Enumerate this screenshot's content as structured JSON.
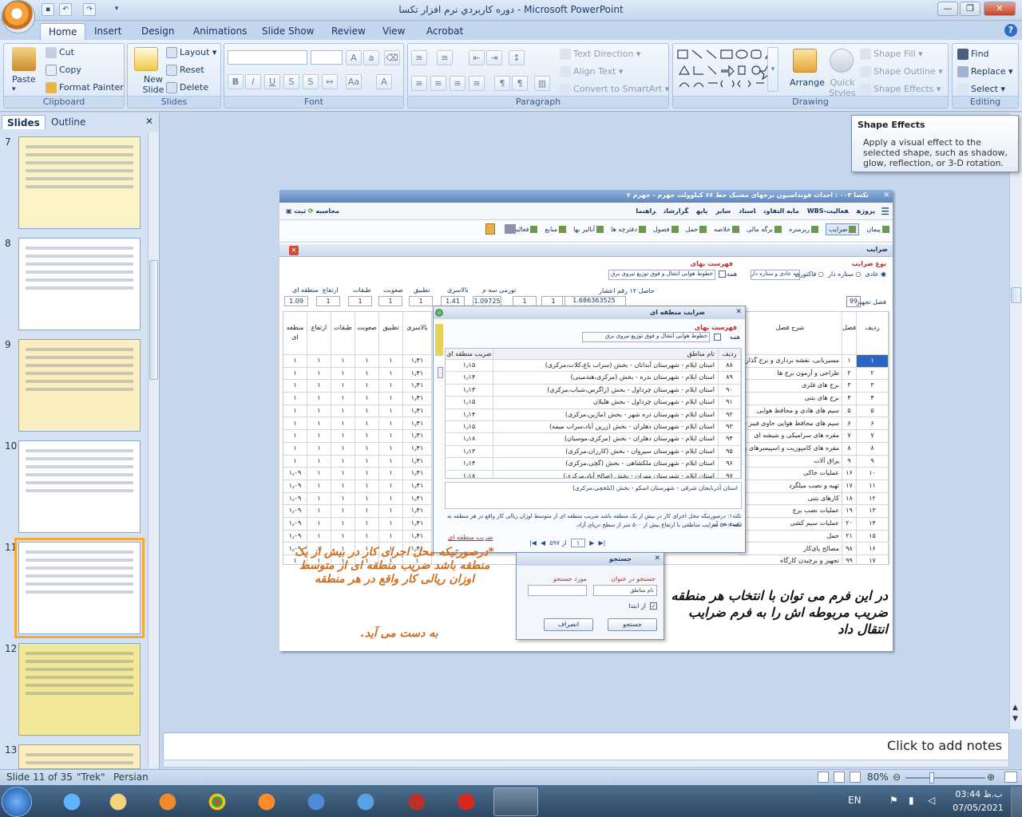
{
  "window": {
    "title": "دوره کاربردي نرم افزار تکسا - Microsoft PowerPoint"
  },
  "tabs": [
    "Home",
    "Insert",
    "Design",
    "Animations",
    "Slide Show",
    "Review",
    "View",
    "Acrobat"
  ],
  "ribbon": {
    "clipboard": {
      "label": "Clipboard",
      "paste": "Paste",
      "cut": "Cut",
      "copy": "Copy",
      "format_painter": "Format Painter"
    },
    "slides": {
      "label": "Slides",
      "new_slide": "New Slide",
      "layout": "Layout",
      "reset": "Reset",
      "delete": "Delete"
    },
    "font": {
      "label": "Font"
    },
    "paragraph": {
      "label": "Paragraph",
      "text_direction": "Text Direction",
      "align_text": "Align Text",
      "convert": "Convert to SmartArt"
    },
    "drawing": {
      "label": "Drawing",
      "arrange": "Arrange",
      "quick_styles": "Quick Styles",
      "shape_fill": "Shape Fill",
      "shape_outline": "Shape Outline",
      "shape_effects": "Shape Effects"
    },
    "editing": {
      "label": "Editing",
      "find": "Find",
      "replace": "Replace",
      "select": "Select"
    }
  },
  "tooltip": {
    "title": "Shape Effects",
    "body": "Apply a visual effect to the selected shape, such as shadow, glow, reflection, or 3-D rotation."
  },
  "left_pane": {
    "tab_slides": "Slides",
    "tab_outline": "Outline",
    "thumbs": [
      {
        "num": "7",
        "bg": "#fbf3c8"
      },
      {
        "num": "8",
        "bg": "#ffffff"
      },
      {
        "num": "9",
        "bg": "#fbeec0"
      },
      {
        "num": "10",
        "bg": "#ffffff"
      },
      {
        "num": "11",
        "bg": "#ffffff"
      },
      {
        "num": "12",
        "bg": "#f3e89a"
      },
      {
        "num": "13",
        "bg": "#fbeec0"
      }
    ]
  },
  "notes": {
    "placeholder": "Click to add notes"
  },
  "status": {
    "slide": "Slide 11 of 35",
    "theme": "\"Trek\"",
    "language": "Persian",
    "zoom": "80%"
  },
  "tray": {
    "lang": "EN",
    "time": "03:44 ب.ظ",
    "date": "07/05/2021"
  },
  "app": {
    "title": "تکسا ۰۰۳ : احداث فونداسیون برجهای مشبک خط ۶۶ کیلوولت جهرم - جهرم ۲",
    "menu": [
      "پروژه",
      "فعالیت-WBS",
      "مابه التفاوت",
      "اسناد",
      "سایر",
      "پایه",
      "گزارشات",
      "راهنما"
    ],
    "menu_right": [
      "ثبت",
      "محاسبه"
    ],
    "toolbar": [
      "پیمان",
      "ضرایب",
      "ریزمتره",
      "برگه مالی",
      "خلاصه",
      "حمل",
      "فصول",
      "دفترچه ها",
      "آنالیز بها",
      "منابع",
      "فعالیت"
    ],
    "active_tab": "ضرایب",
    "coef_type_label": "نوع ضرایب",
    "coef_types": [
      "عادی",
      "ستاره دار",
      "فاکتوری"
    ],
    "coef_type_combo": "به عادی و ستاره دار",
    "price_list_label": "فهرست بهای",
    "price_list_value": "خطوط هوایی انتقال و فوق توزیع نیروی برق",
    "all_label": "همه",
    "result_label": "حاصل ۱۲ رقم اعشار",
    "result_value": "1.686363525",
    "coef_headers": [
      "منطقه ای",
      "ارتفاع",
      "طبقات",
      "صعوبت",
      "تطبیق",
      "بالاسری",
      "تورمی سه م"
    ],
    "coef_values": [
      "1.09",
      "1",
      "1",
      "1",
      "1",
      "1.41",
      "1.09725",
      "1",
      "1"
    ],
    "chapter_label": "فصل تجهیز",
    "chapter_value": "99",
    "grid_headers": [
      "ردیف",
      "فصل",
      "شرح فصل",
      "بالاسری",
      "تطبیق",
      "صعوبت",
      "طبقات",
      "ارتفاع",
      "منطقه ای"
    ],
    "rows": [
      [
        "۱",
        "۱",
        "مسیربابی، نقشه برداری و برج گذاری",
        "۱٫۴۱",
        "۱",
        "۱",
        "۱",
        "۱",
        "۱"
      ],
      [
        "۲",
        "۲",
        "طراحی و آزمون برج ها",
        "۱٫۴۱",
        "۱",
        "۱",
        "۱",
        "۱",
        "۱"
      ],
      [
        "۳",
        "۳",
        "برج های فلزی",
        "۱٫۴۱",
        "۱",
        "۱",
        "۱",
        "۱",
        "۱"
      ],
      [
        "۴",
        "۴",
        "برج های بتنی",
        "۱٫۴۱",
        "۱",
        "۱",
        "۱",
        "۱",
        "۱"
      ],
      [
        "۵",
        "۵",
        "سیم های هادی و محافظ هوایی",
        "۱٫۴۱",
        "۱",
        "۱",
        "۱",
        "۱",
        "۱"
      ],
      [
        "۶",
        "۶",
        "سیم های محافظ هوایی حاوی فیبر نوری",
        "۱٫۴۱",
        "۱",
        "۱",
        "۱",
        "۱",
        "۱"
      ],
      [
        "۷",
        "۷",
        "مقره های سرامیکی و شیشه ای",
        "۱٫۴۱",
        "۱",
        "۱",
        "۱",
        "۱",
        "۱"
      ],
      [
        "۸",
        "۸",
        "مقره های کامپوزیت و اسپیسرهای بین فازی",
        "۱٫۴۱",
        "۱",
        "۱",
        "۱",
        "۱",
        "۱"
      ],
      [
        "۹",
        "۹",
        "یراق آلات",
        "۱٫۴۱",
        "۱",
        "۱",
        "۱",
        "۱",
        "۱"
      ],
      [
        "۱۰",
        "۱۶",
        "عملیات خاکی",
        "۱٫۴۱",
        "۱",
        "۱",
        "۱",
        "۱",
        "۱٫۰۹"
      ],
      [
        "۱۱",
        "۱۷",
        "تهیه و نصب میلگرد",
        "۱٫۴۱",
        "۱",
        "۱",
        "۱",
        "۱",
        "۱٫۰۹"
      ],
      [
        "۱۲",
        "۱۸",
        "کارهای بتنی",
        "۱٫۴۱",
        "۱",
        "۱",
        "۱",
        "۱",
        "۱٫۰۹"
      ],
      [
        "۱۳",
        "۱۹",
        "عملیات نصب برج",
        "۱٫۴۱",
        "۱",
        "۱",
        "۱",
        "۱",
        "۱٫۰۹"
      ],
      [
        "۱۴",
        "۲۰",
        "عملیات سیم کشی",
        "۱٫۴۱",
        "۱",
        "۱",
        "۱",
        "۱",
        "۱٫۰۹"
      ],
      [
        "۱۵",
        "۲۱",
        "حمل",
        "۱٫۴۱",
        "۱",
        "۱",
        "۱",
        "۱",
        "۱٫۰۹"
      ],
      [
        "۱۶",
        "۹۸",
        "مصالح پای‌کار",
        "۱٫۴۱",
        "۱",
        "۱",
        "۱",
        "۱",
        "۱٫۰۹"
      ],
      [
        "۱۷",
        "۹۹",
        "تجهیز و برچیدن کارگاه",
        "۱",
        "۱",
        "۱",
        "۱",
        "۱",
        "۱"
      ]
    ],
    "popup": {
      "title": "ضرایب منطقه ای",
      "price_list_label": "فهرست بهای",
      "price_list_value": "خطوط هوایی انتقال و فوق توزیع نیروی برق",
      "all_label": "همه",
      "headers": [
        "ردیف",
        "نام مناطق",
        "ضریب منطقه ای"
      ],
      "rows": [
        [
          "۸۸",
          "استان ایلام - شهرستان آبدانان - بخش (سراب باغ،کلات،مرکزی)",
          "۱٫۱۵"
        ],
        [
          "۸۹",
          "استان ایلام - شهرستان بدره - بخش (مرکزی،هندمینی)",
          "۱٫۱۴"
        ],
        [
          "۹۰",
          "استان ایلام - شهرستان چرداول - بخش (زاگرس،شباب،مرکزی)",
          "۱٫۱۳"
        ],
        [
          "۹۱",
          "استان ایلام - شهرستان چرداول - بخش هلیلان",
          "۱٫۱۵"
        ],
        [
          "۹۲",
          "استان ایلام - شهرستان دره شهر - بخش (ماژین،مرکزی)",
          "۱٫۱۴"
        ],
        [
          "۹۳",
          "استان ایلام - شهرستان دهلران - بخش (زرین آباد،سراب میمه)",
          "۱٫۱۵"
        ],
        [
          "۹۴",
          "استان ایلام - شهرستان دهلران - بخش (مرکزی،موسیان)",
          "۱٫۱۸"
        ],
        [
          "۹۵",
          "استان ایلام - شهرستان سیروان - بخش (کارزان،مرکزی)",
          "۱٫۱۳"
        ],
        [
          "۹۶",
          "استان ایلام - شهرستان ملکشاهی - بخش (گچی،مرکزی)",
          "۱٫۱۴"
        ],
        [
          "۹۷",
          "استان ایلام - شهرستان مهران - بخش (صالح آباد،مرکزی)",
          "۱٫۱۸"
        ]
      ],
      "detail": "استان آذربایجان شرقی - شهرستان اسکو - بخش (ایلخچی،مرکزی)",
      "note1": "نکته۱: درصورتیکه محل اجرای کار در بیش از یک منطقه باشد ضریب منطقه ای از متوسط اوزان ریالی کار واقع در هر منطقه به دست می آید",
      "note2": "نکته۲: ** ضرایب مناطقی با ارتفاع بیش از ۵۰۰ متر از سطح دریای آزاد.",
      "link": "ضریب منطقه ای",
      "pager_of": "از ۵۹۷",
      "pager_page": "۱"
    },
    "search": {
      "title": "جستجو",
      "field_label": "جستجو در عنوان",
      "field_value": "نام مناطق",
      "term_label": "مورد جستجو",
      "from_start": "از ابتدا",
      "search_btn": "جستجو",
      "cancel_btn": "انصراف"
    }
  },
  "annotations": {
    "orange": "*درصورتیکه محل اجرای کار در بیش از یک منطقه باشد ضریب منطقه ای از متوسط اوزان ریالی کار واقع در هر منطقه",
    "orange2": "به دست می آید.",
    "black": "در این فرم می توان با انتخاب هر منطقه ضریب مربوطه اش را به فرم ضرایب انتقال داد"
  }
}
